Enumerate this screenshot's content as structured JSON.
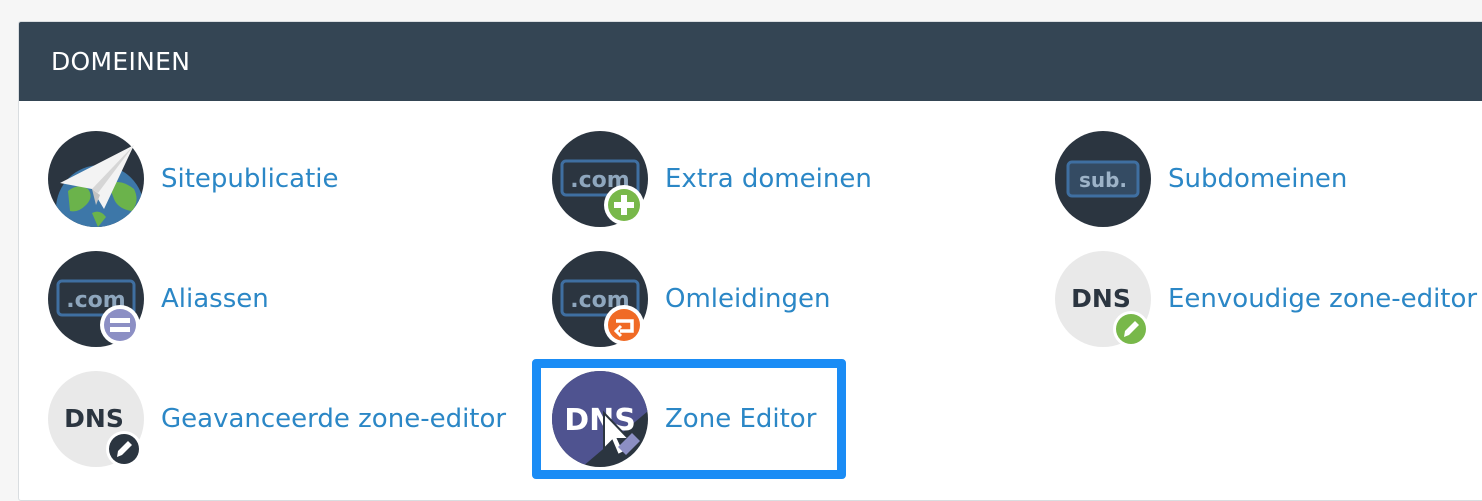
{
  "section": {
    "title": "DOMEINEN"
  },
  "items": [
    {
      "label": "Sitepublicatie",
      "icon": "paper-plane-globe-icon"
    },
    {
      "label": "Extra domeinen",
      "icon": "dotcom-add-icon",
      "icon_text": ".com"
    },
    {
      "label": "Subdomeinen",
      "icon": "subdomain-icon",
      "icon_text": "sub."
    },
    {
      "label": "Aliassen",
      "icon": "dotcom-equals-icon",
      "icon_text": ".com"
    },
    {
      "label": "Omleidingen",
      "icon": "dotcom-redirect-icon",
      "icon_text": ".com"
    },
    {
      "label": "Eenvoudige zone-editor",
      "icon": "dns-pencil-green-icon",
      "icon_text": "DNS"
    },
    {
      "label": "Geavanceerde zone-editor",
      "icon": "dns-pencil-dark-icon",
      "icon_text": "DNS"
    },
    {
      "label": "Zone Editor",
      "icon": "dns-cursor-icon",
      "icon_text": "DNS"
    }
  ],
  "highlighted_item": "Zone Editor",
  "colors": {
    "header_bg": "#344554",
    "link": "#2b87c6",
    "highlight": "#1a8cf5",
    "icon_dark": "#2b3540",
    "green_badge": "#78b84a",
    "orange_badge": "#f06a25",
    "purple_badge": "#8c8fc4"
  }
}
